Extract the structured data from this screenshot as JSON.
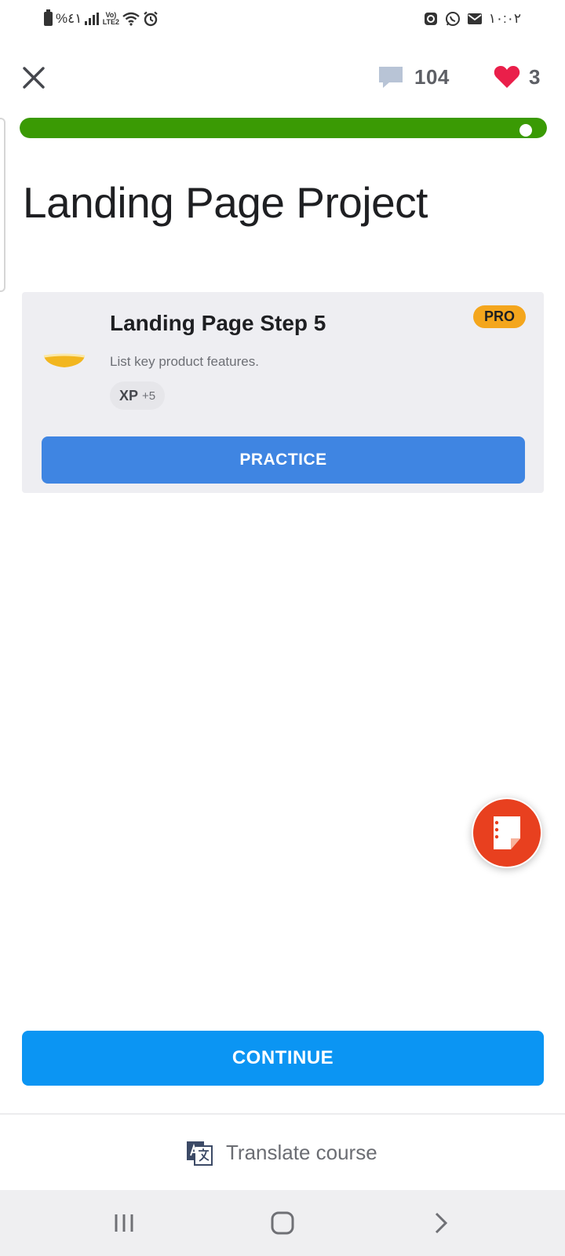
{
  "status_bar": {
    "battery_percent": "%٤١",
    "volte_label": "Vo) LTE2",
    "time": "١٠:٠٢"
  },
  "header": {
    "comments_count": "104",
    "hearts_count": "3",
    "progress": 0.96
  },
  "page_title": "Landing Page Project",
  "lesson_card": {
    "title": "Landing Page Step 5",
    "badge": "PRO",
    "description": "List key product features.",
    "xp_label": "XP",
    "xp_value": "+5",
    "practice_label": "PRACTICE"
  },
  "continue_label": "CONTINUE",
  "translate_label": "Translate course",
  "colors": {
    "progress_green": "#3a9a04",
    "practice_blue": "#3f85e2",
    "continue_blue": "#0b95f3",
    "pro_orange": "#f4a61d",
    "heart_red": "#ea1f4a",
    "notes_red": "#e8401f"
  },
  "icons": {
    "close": "close-icon",
    "comments": "speech-bubble-icon",
    "hearts": "heart-icon",
    "notes": "notes-icon",
    "translate": "translate-icon"
  }
}
